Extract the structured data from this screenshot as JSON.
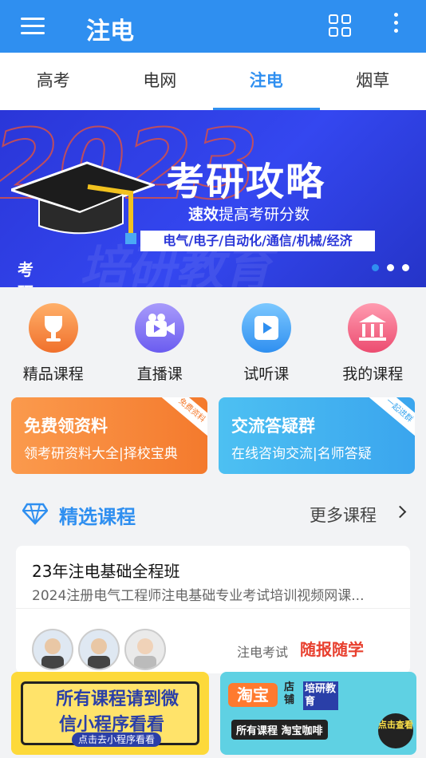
{
  "header": {
    "title": "注电",
    "menu_icon": "hamburger-icon",
    "grid_icon": "grid-icon",
    "more_icon": "more-vertical-icon"
  },
  "tabs": [
    {
      "label": "高考",
      "active": false
    },
    {
      "label": "电网",
      "active": false
    },
    {
      "label": "注电",
      "active": true
    },
    {
      "label": "烟草",
      "active": false
    }
  ],
  "banner": {
    "headline": "考研攻略",
    "sub_bold": "速效",
    "sub_rest": "提高考研分数",
    "subjects": "电气/电子/自动化/通信/机械/经济",
    "label": "考研",
    "bg_number": "2023",
    "watermark": "培研教育",
    "slide_count": 3,
    "active_slide": 1
  },
  "quick_links": [
    {
      "label": "精品课程",
      "icon": "trophy-icon",
      "color": "#f5823a"
    },
    {
      "label": "直播课",
      "icon": "video-camera-icon",
      "color": "#7b6cf5"
    },
    {
      "label": "试听课",
      "icon": "play-video-icon",
      "color": "#3fa3f5"
    },
    {
      "label": "我的课程",
      "icon": "library-icon",
      "color": "#f05a7a"
    }
  ],
  "promos": [
    {
      "title": "免费领资料",
      "subtitle": "领考研资料大全|择校宝典",
      "corner": "免费资料",
      "color": "#f98a3d"
    },
    {
      "title": "交流答疑群",
      "subtitle": "在线咨询交流|名师答疑",
      "corner": "一起进群",
      "color": "#4bb7f0"
    }
  ],
  "section": {
    "title": "精选课程",
    "more": "更多课程",
    "icon": "diamond-icon"
  },
  "course": {
    "title": "23年注电基础全程班",
    "desc": "2024注册电气工程师注电基础专业考试培训视频网课...",
    "category": "注电考试",
    "tag": "随报随学",
    "avatars": 3
  },
  "ads": [
    {
      "text_line1": "所有课程请到微",
      "text_line2": "信小程序看看",
      "button": "点击去小程序看看"
    },
    {
      "brand": "淘宝",
      "store": "店铺",
      "name": "培研教育",
      "tagline": "所有课程 淘宝咖啡",
      "button": "点击查看"
    }
  ]
}
